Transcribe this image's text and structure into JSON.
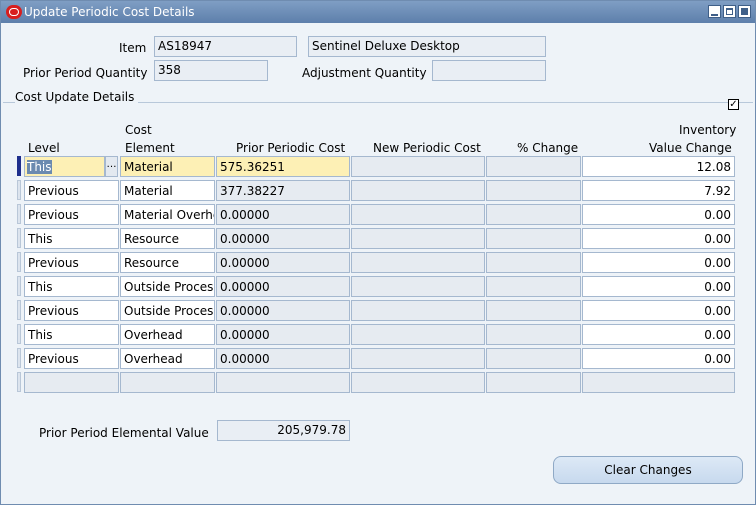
{
  "window": {
    "title": "Update Periodic Cost Details"
  },
  "header": {
    "item_label": "Item",
    "item_value": "AS18947",
    "item_description": "Sentinel Deluxe Desktop",
    "prior_qty_label": "Prior Period Quantity",
    "prior_qty_value": "358",
    "adjustment_qty_label": "Adjustment Quantity",
    "adjustment_qty_value": ""
  },
  "section": {
    "title": "Cost Update Details",
    "checkbox_checked": true,
    "checkbox_mark": "✓"
  },
  "table": {
    "columns": {
      "level": "Level",
      "cost_element_1": "Cost",
      "cost_element_2": "Element",
      "prior_cost": "Prior Periodic Cost",
      "new_cost": "New Periodic Cost",
      "pct_change": "% Change",
      "inv_change_1": "Inventory",
      "inv_change_2": "Value Change"
    },
    "rows": [
      {
        "level": "This",
        "element": "Material",
        "prior": "575.36251",
        "new": "",
        "pct": "",
        "inv": "12.08"
      },
      {
        "level": "Previous",
        "element": "Material",
        "prior": "377.38227",
        "new": "",
        "pct": "",
        "inv": "7.92"
      },
      {
        "level": "Previous",
        "element": "Material Overhe",
        "prior": "0.00000",
        "new": "",
        "pct": "",
        "inv": "0.00"
      },
      {
        "level": "This",
        "element": "Resource",
        "prior": "0.00000",
        "new": "",
        "pct": "",
        "inv": "0.00"
      },
      {
        "level": "Previous",
        "element": "Resource",
        "prior": "0.00000",
        "new": "",
        "pct": "",
        "inv": "0.00"
      },
      {
        "level": "This",
        "element": "Outside Proces",
        "prior": "0.00000",
        "new": "",
        "pct": "",
        "inv": "0.00"
      },
      {
        "level": "Previous",
        "element": "Outside Proces",
        "prior": "0.00000",
        "new": "",
        "pct": "",
        "inv": "0.00"
      },
      {
        "level": "This",
        "element": "Overhead",
        "prior": "0.00000",
        "new": "",
        "pct": "",
        "inv": "0.00"
      },
      {
        "level": "Previous",
        "element": "Overhead",
        "prior": "0.00000",
        "new": "",
        "pct": "",
        "inv": "0.00"
      },
      {
        "level": "",
        "element": "",
        "prior": "",
        "new": "",
        "pct": "",
        "inv": ""
      }
    ],
    "lov_glyph": "…"
  },
  "footer": {
    "elemental_label": "Prior Period Elemental Value",
    "elemental_value": "205,979.78",
    "clear_button": "Clear Changes"
  }
}
